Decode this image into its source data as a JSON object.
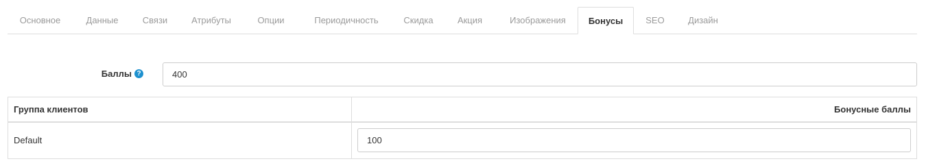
{
  "tabs": [
    {
      "label": "Основное",
      "active": false
    },
    {
      "label": "Данные",
      "active": false
    },
    {
      "label": "Связи",
      "active": false
    },
    {
      "label": "Атрибуты",
      "active": false
    },
    {
      "label": "Опции",
      "active": false
    },
    {
      "label": "Периодичность",
      "active": false
    },
    {
      "label": "Скидка",
      "active": false
    },
    {
      "label": "Акция",
      "active": false
    },
    {
      "label": "Изображения",
      "active": false
    },
    {
      "label": "Бонусы",
      "active": true
    },
    {
      "label": "SEO",
      "active": false
    },
    {
      "label": "Дизайн",
      "active": false
    }
  ],
  "points": {
    "label": "Баллы",
    "help_icon": "question-circle-icon",
    "value": "400"
  },
  "reward_table": {
    "headers": {
      "customer_group": "Группа клиентов",
      "bonus_points": "Бонусные баллы"
    },
    "rows": [
      {
        "customer_group": "Default",
        "points": "100"
      }
    ]
  },
  "colors": {
    "accent": "#1e91cf",
    "border": "#dddddd",
    "inactive_tab_text": "#9a9a9a"
  }
}
